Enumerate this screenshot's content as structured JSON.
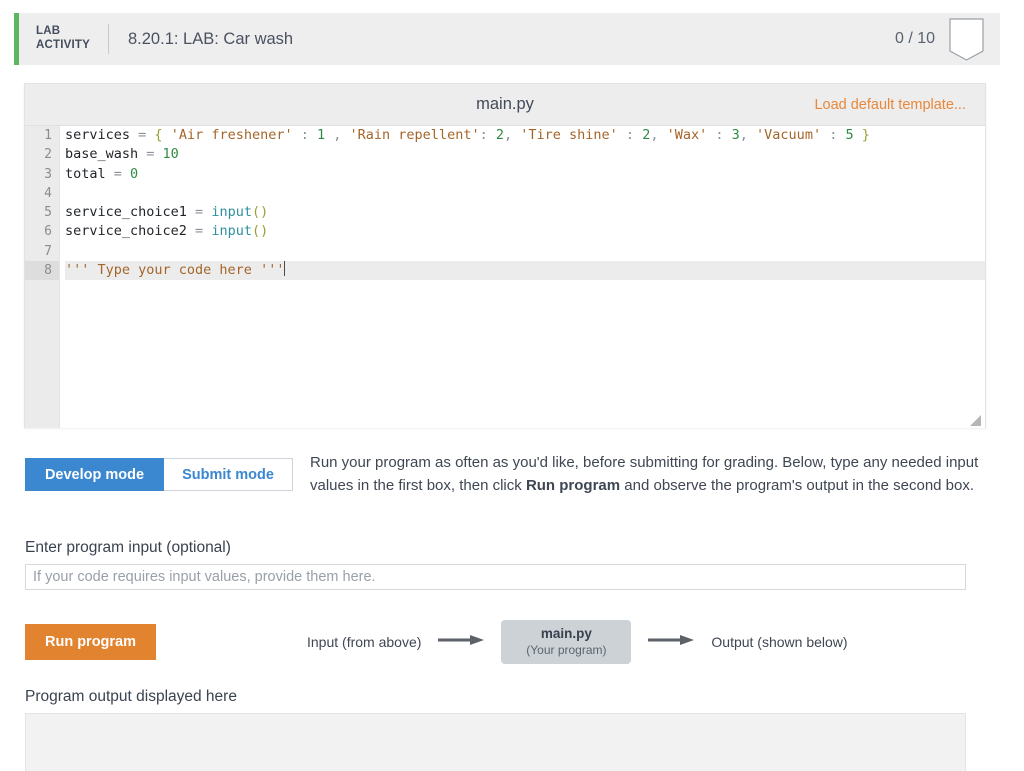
{
  "header": {
    "badge_label": "LAB\nACTIVITY",
    "title": "8.20.1: LAB: Car wash",
    "score": "0 / 10",
    "bookmark_icon": "bookmark-icon",
    "accent_color": "#5fb55f"
  },
  "editor": {
    "filename": "main.py",
    "load_template_label": "Load default template...",
    "resize_handle_icon": "resize-grip-icon",
    "active_line": 8,
    "line_numbers": [
      "1",
      "2",
      "3",
      "4",
      "5",
      "6",
      "7",
      "8"
    ],
    "lines": [
      {
        "n": "1",
        "tokens": [
          {
            "t": "services ",
            "c": "plain"
          },
          {
            "t": "= ",
            "c": "op"
          },
          {
            "t": "{ ",
            "c": "paren"
          },
          {
            "t": "'Air freshener' ",
            "c": "str"
          },
          {
            "t": ": ",
            "c": "op"
          },
          {
            "t": "1 ",
            "c": "num"
          },
          {
            "t": ", ",
            "c": "op"
          },
          {
            "t": "'Rain repellent'",
            "c": "str"
          },
          {
            "t": ": ",
            "c": "op"
          },
          {
            "t": "2",
            "c": "num"
          },
          {
            "t": ", ",
            "c": "op"
          },
          {
            "t": "'Tire shine' ",
            "c": "str"
          },
          {
            "t": ": ",
            "c": "op"
          },
          {
            "t": "2",
            "c": "num"
          },
          {
            "t": ", ",
            "c": "op"
          },
          {
            "t": "'Wax' ",
            "c": "str"
          },
          {
            "t": ": ",
            "c": "op"
          },
          {
            "t": "3",
            "c": "num"
          },
          {
            "t": ", ",
            "c": "op"
          },
          {
            "t": "'Vacuum' ",
            "c": "str"
          },
          {
            "t": ": ",
            "c": "op"
          },
          {
            "t": "5 ",
            "c": "num"
          },
          {
            "t": "}",
            "c": "paren"
          }
        ]
      },
      {
        "n": "2",
        "tokens": [
          {
            "t": "base_wash ",
            "c": "plain"
          },
          {
            "t": "= ",
            "c": "op"
          },
          {
            "t": "10",
            "c": "num"
          }
        ]
      },
      {
        "n": "3",
        "tokens": [
          {
            "t": "total ",
            "c": "plain"
          },
          {
            "t": "= ",
            "c": "op"
          },
          {
            "t": "0",
            "c": "num"
          }
        ]
      },
      {
        "n": "4",
        "tokens": []
      },
      {
        "n": "5",
        "tokens": [
          {
            "t": "service_choice1 ",
            "c": "plain"
          },
          {
            "t": "= ",
            "c": "op"
          },
          {
            "t": "input",
            "c": "fn"
          },
          {
            "t": "()",
            "c": "paren"
          }
        ]
      },
      {
        "n": "6",
        "tokens": [
          {
            "t": "service_choice2 ",
            "c": "plain"
          },
          {
            "t": "= ",
            "c": "op"
          },
          {
            "t": "input",
            "c": "fn"
          },
          {
            "t": "()",
            "c": "paren"
          }
        ]
      },
      {
        "n": "7",
        "tokens": []
      },
      {
        "n": "8",
        "tokens": [
          {
            "t": "''' Type your code here '''",
            "c": "str"
          }
        ]
      }
    ]
  },
  "modes": {
    "develop_label": "Develop mode",
    "submit_label": "Submit mode",
    "active": "Develop mode",
    "active_color": "#3b87d0"
  },
  "instructions": {
    "part1": "Run your program as often as you'd like, before submitting for grading. Below, type any needed input values in the first box, then click ",
    "bold": "Run program",
    "part2": " and observe the program's output in the second box."
  },
  "program_input": {
    "label": "Enter program input (optional)",
    "placeholder": "If your code requires input values, provide them here.",
    "value": ""
  },
  "run": {
    "button_label": "Run program",
    "button_color": "#e2832f"
  },
  "flow": {
    "input_label": "Input (from above)",
    "program_title": "main.py",
    "program_subtitle": "(Your program)",
    "output_label": "Output (shown below)",
    "arrow_icon": "right-arrow-icon"
  },
  "output": {
    "label": "Program output displayed here",
    "content": ""
  }
}
